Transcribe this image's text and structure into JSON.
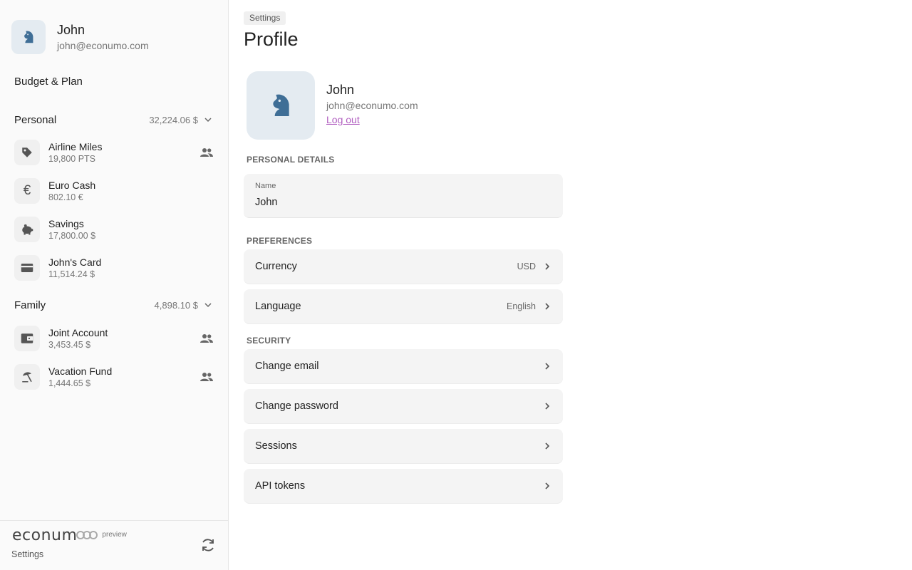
{
  "sidebar": {
    "user": {
      "name": "John",
      "email": "john@econumo.com",
      "avatar_icon": "horse-head-icon"
    },
    "nav": {
      "budget_plan": "Budget & Plan"
    },
    "groups": [
      {
        "title": "Personal",
        "total": "32,224.06 $",
        "accounts": [
          {
            "name": "Airline Miles",
            "balance": "19,800 PTS",
            "icon": "tag-icon",
            "shared": true
          },
          {
            "name": "Euro Cash",
            "balance": "802.10 €",
            "icon": "euro-icon",
            "shared": false
          },
          {
            "name": "Savings",
            "balance": "17,800.00 $",
            "icon": "piggy-bank-icon",
            "shared": false
          },
          {
            "name": "John's Card",
            "balance": "11,514.24 $",
            "icon": "credit-card-icon",
            "shared": false
          }
        ]
      },
      {
        "title": "Family",
        "total": "4,898.10 $",
        "accounts": [
          {
            "name": "Joint Account",
            "balance": "3,453.45 $",
            "icon": "wallet-icon",
            "shared": true
          },
          {
            "name": "Vacation Fund",
            "balance": "1,444.65 $",
            "icon": "beach-umbrella-icon",
            "shared": true
          }
        ]
      }
    ],
    "footer": {
      "logo": "econum",
      "badge": "preview",
      "settings": "Settings",
      "sync_icon": "sync-icon"
    }
  },
  "main": {
    "breadcrumb": "Settings",
    "title": "Profile",
    "profile": {
      "name": "John",
      "email": "john@econumo.com",
      "logout": "Log out"
    },
    "personal_details": {
      "label": "PERSONAL DETAILS",
      "name_label": "Name",
      "name_value": "John"
    },
    "preferences": {
      "label": "PREFERENCES",
      "currency": {
        "label": "Currency",
        "value": "USD"
      },
      "language": {
        "label": "Language",
        "value": "English"
      }
    },
    "security": {
      "label": "SECURITY",
      "change_email": "Change email",
      "change_password": "Change password",
      "sessions": "Sessions",
      "api_tokens": "API tokens"
    }
  },
  "colors": {
    "accent_link": "#b15ec0",
    "avatar_bg": "#e4ebf1",
    "avatar_fg": "#3f6e96",
    "sidebar_bg": "#fafafa",
    "row_bg": "#f4f4f4"
  }
}
